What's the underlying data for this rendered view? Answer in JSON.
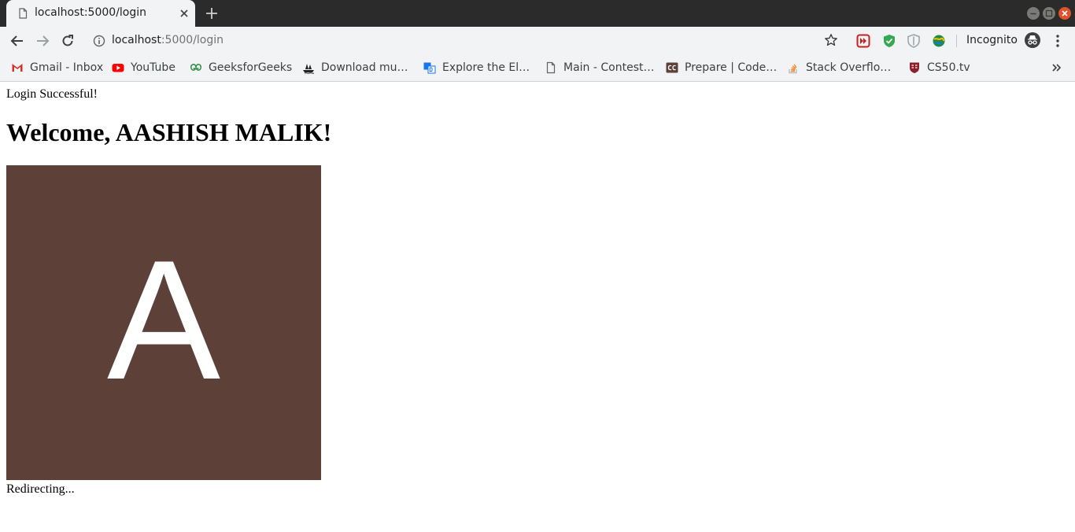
{
  "browser": {
    "tab": {
      "title": "localhost:5000/login"
    },
    "address": {
      "host": "localhost",
      "rest": ":5000/login"
    },
    "incognito_label": "Incognito",
    "colors": {
      "frame": "#2b2b2b",
      "toolbar": "#f1f3f4",
      "close_button": "#e0522b"
    }
  },
  "bookmarks": [
    {
      "label": "Gmail - Inbox",
      "icon": "gmail-icon"
    },
    {
      "label": "YouTube",
      "icon": "youtube-icon"
    },
    {
      "label": "GeeksforGeeks",
      "icon": "geeksforgeeks-icon"
    },
    {
      "label": "Download mu…",
      "icon": "ship-icon"
    },
    {
      "label": "Explore the El…",
      "icon": "dc-icon"
    },
    {
      "label": "Main - Contest…",
      "icon": "page-icon"
    },
    {
      "label": "Prepare | Code…",
      "icon": "cc-icon"
    },
    {
      "label": "Stack Overflo…",
      "icon": "stackoverflow-icon"
    },
    {
      "label": "CS50.tv",
      "icon": "shield-crest-icon"
    }
  ],
  "page": {
    "flash_message": "Login Successful!",
    "welcome_heading": "Welcome, AASHISH MALIK!",
    "avatar": {
      "letter": "A",
      "background": "#5d4037",
      "color": "#ffffff"
    },
    "status_text": "Redirecting..."
  }
}
